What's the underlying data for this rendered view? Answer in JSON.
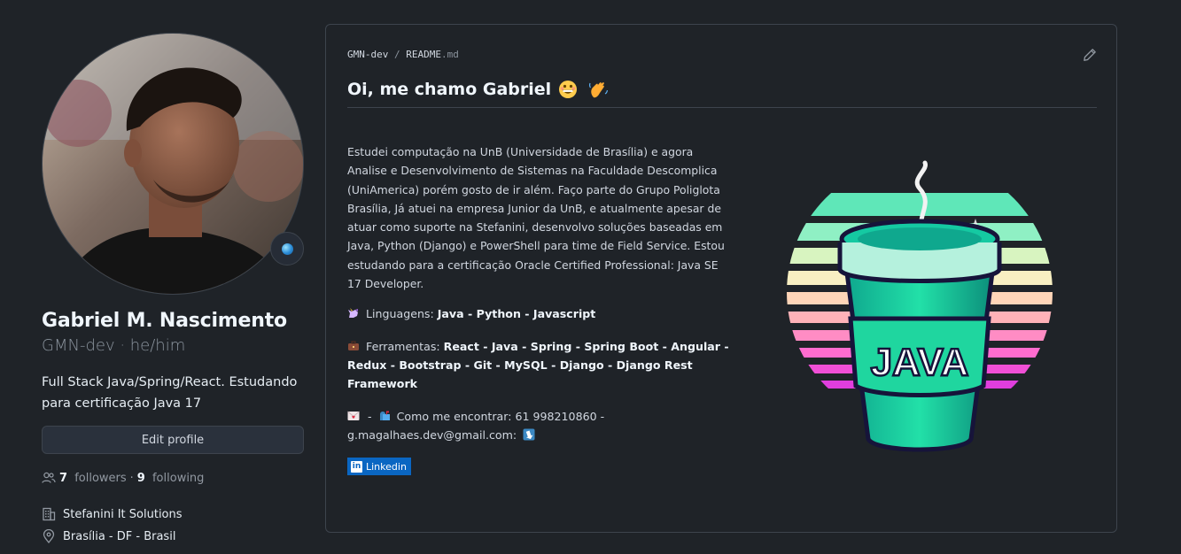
{
  "profile": {
    "full_name": "Gabriel M. Nascimento",
    "login_pronouns": "GMN-dev · he/him",
    "bio": "Full Stack Java/Spring/React. Estudando para certificação Java 17",
    "edit_profile_label": "Edit profile",
    "followers_count": "7",
    "followers_label": "followers",
    "following_count": "9",
    "following_label": "following",
    "separator": "·",
    "company": "Stefanini It Solutions",
    "location": "Brasília - DF - Brasil"
  },
  "readme": {
    "breadcrumb_user": "GMN-dev",
    "breadcrumb_sep": "/",
    "breadcrumb_file": "README",
    "breadcrumb_ext": ".md",
    "title": "Oi, me chamo Gabriel",
    "paragraph": "Estudei computação na UnB (Universidade de Brasília) e agora Analise e Desenvolvimento de Sistemas na Faculdade Descomplica (UniAmerica) porém gosto de ir além. Faço parte do Grupo Poliglota Brasília, Já atuei na empresa Junior da UnB, e atualmente apesar de atuar como suporte na Stefanini, desenvolvo soluções baseadas em Java, Python (Django) e PowerShell para time de Field Service. Estou estudando para a certificação Oracle Certified Professional: Java SE 17 Developer.",
    "languages_label": "Linguagens:",
    "languages": "Java - Python - Javascript",
    "tools_label": "Ferramentas:",
    "tools": "React - Java - Spring - Spring Boot - Angular - Redux - Bootstrap - Git - MySQL - Django - Django Rest Framework",
    "contact_prefix": "-",
    "contact_text": "Como me encontrar: 61 998210860 -",
    "contact_email": "g.magalhaes.dev@gmail.com:",
    "linkedin_label": "Linkedin",
    "java_logo_text": "JAVA"
  },
  "icons": {
    "pencil": "pencil-icon",
    "people": "people-icon",
    "organization": "organization-icon",
    "location": "location-icon"
  },
  "colors": {
    "background": "#1f2328",
    "border": "#3d444d",
    "linkedin": "#0a66c2",
    "cup_teal": "#1fd1a0"
  }
}
